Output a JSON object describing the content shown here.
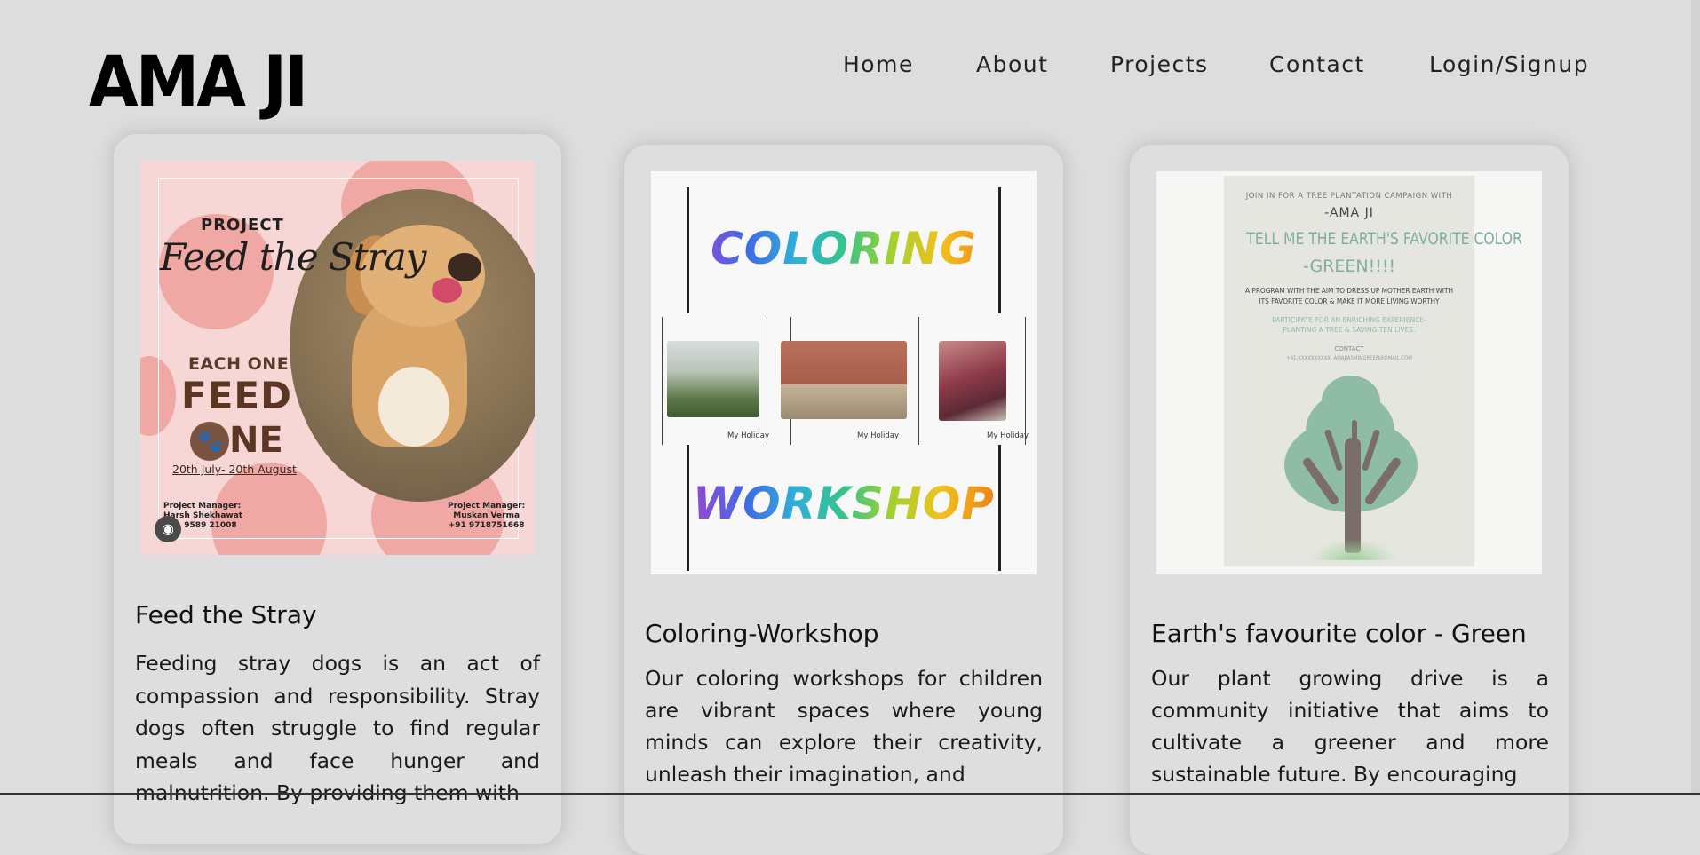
{
  "header": {
    "logo": "AMA JI",
    "nav": [
      {
        "label": "Home"
      },
      {
        "label": "About"
      },
      {
        "label": "Projects"
      },
      {
        "label": "Contact"
      },
      {
        "label": "Login/Signup"
      }
    ]
  },
  "cards": [
    {
      "title": "Feed the Stray",
      "text": "Feeding stray dogs is an act of compassion and responsibility. Stray dogs often struggle to find regular meals and face hunger and malnutrition. By providing them with",
      "poster": {
        "project": "PROJECT",
        "headline": "Feed the Stray",
        "each_one": "EACH ONE",
        "feed": "FEED",
        "one": "NE",
        "paw_icon": "paw-icon",
        "dates": "20th July- 20th August",
        "pm_left": [
          "Project Manager:",
          "Harsh Shekhawat",
          "+91 9589 21008"
        ],
        "pm_right": [
          "Project Manager:",
          "Muskan Verma",
          "+91 9718751668"
        ]
      }
    },
    {
      "title": "Coloring-Workshop",
      "text": "Our coloring workshops for children are vibrant spaces where young minds can explore their creativity, unleash their imagination, and",
      "poster": {
        "top_word": "COLORING",
        "bottom_word": "WORKSHOP",
        "captions": [
          "My Holiday",
          "My Holiday",
          "My Holiday"
        ]
      }
    },
    {
      "title": "Earth's favourite color - Green",
      "text": "Our plant growing drive is a community initiative that aims to cultivate a greener and more sustainable future. By encouraging",
      "poster": {
        "lines": [
          "JOIN IN FOR A TREE PLANTATION CAMPAIGN WITH",
          "-AMA JI",
          "TELL ME THE EARTH'S FAVORITE COLOR",
          "-GREEN!!!!",
          "A PROGRAM WITH THE AIM TO DRESS UP MOTHER EARTH WITH",
          "ITS FAVORITE COLOR & MAKE IT MORE LIVING WORTHY",
          "PARTICIPATE FOR AN ENRICHING EXPERIENCE-",
          "PLANTING A TREE & SAVING TEN LIVES.",
          "CONTACT",
          "+91-XXXXXXXXXX, AMAJIASMINGREEN@GMAIL.COM"
        ]
      }
    }
  ],
  "colors": {
    "background": "#dddddd",
    "card": "#dedede",
    "poster_pink": "#f7d7d5",
    "poster_blob": "#f0a8a4",
    "tree_green": "#8fbca6"
  }
}
